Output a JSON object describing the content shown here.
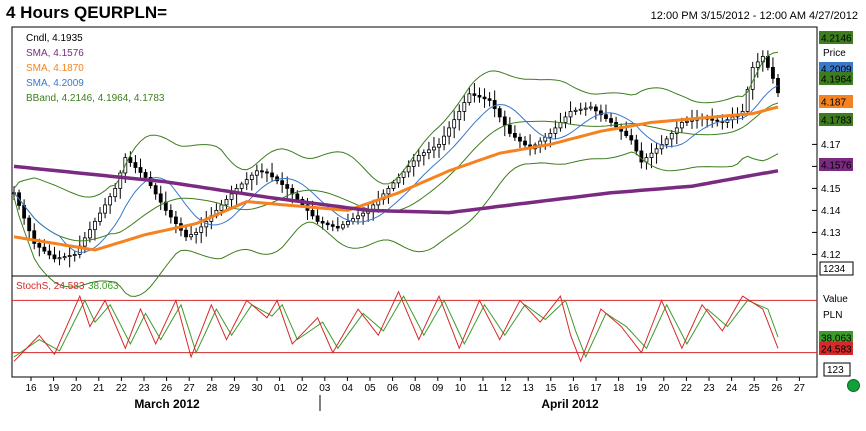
{
  "header": {
    "title": "4 Hours QEURPLN=",
    "range": "12:00 PM 3/15/2012 - 12:00 AM 4/27/2012"
  },
  "chart_data": {
    "type": "line",
    "price_panel": {
      "ylim": [
        4.112,
        4.222
      ],
      "y_ticks": [
        4.12,
        4.13,
        4.14,
        4.15,
        4.16,
        4.17
      ],
      "y_axis_label": "Price",
      "legend": [
        {
          "label": "Cndl, 4.1935",
          "color": "#000000"
        },
        {
          "label": "SMA, 4.1576",
          "color": "#7b2a82"
        },
        {
          "label": "SMA, 4.1870",
          "color": "#f5821f"
        },
        {
          "label": "SMA, 4.2009",
          "color": "#3a78c8"
        },
        {
          "label": "BBand, 4.2146, 4.1964, 4.1783",
          "color": "#3d7d1e"
        }
      ],
      "value_tags": [
        {
          "value": "4.2146",
          "bg": "#3d7d1e",
          "fg": "#ffffff"
        },
        {
          "value": "4.2009",
          "bg": "#3a78c8",
          "fg": "#ffffff"
        },
        {
          "value": "4.1964",
          "bg": "#3d7d1e",
          "fg": "#ffffff"
        },
        {
          "value": "4.187",
          "bg": "#f5821f",
          "fg": "#000000"
        },
        {
          "value": "4.1783",
          "bg": "#3d7d1e",
          "fg": "#ffffff"
        },
        {
          "value": "4.1576",
          "bg": "#7b2a82",
          "fg": "#ffffff"
        }
      ],
      "scale_box": "1234",
      "close_anchors": [
        [
          0,
          4.148
        ],
        [
          4,
          4.125
        ],
        [
          8,
          4.118
        ],
        [
          12,
          4.12
        ],
        [
          16,
          4.135
        ],
        [
          20,
          4.15
        ],
        [
          22,
          4.164
        ],
        [
          26,
          4.155
        ],
        [
          30,
          4.14
        ],
        [
          34,
          4.128
        ],
        [
          36,
          4.13
        ],
        [
          40,
          4.14
        ],
        [
          44,
          4.15
        ],
        [
          48,
          4.158
        ],
        [
          50,
          4.157
        ],
        [
          54,
          4.15
        ],
        [
          58,
          4.14
        ],
        [
          60,
          4.135
        ],
        [
          64,
          4.132
        ],
        [
          66,
          4.135
        ],
        [
          70,
          4.14
        ],
        [
          74,
          4.15
        ],
        [
          78,
          4.16
        ],
        [
          80,
          4.165
        ],
        [
          84,
          4.17
        ],
        [
          88,
          4.185
        ],
        [
          90,
          4.193
        ],
        [
          94,
          4.19
        ],
        [
          98,
          4.175
        ],
        [
          102,
          4.168
        ],
        [
          106,
          4.175
        ],
        [
          110,
          4.185
        ],
        [
          114,
          4.187
        ],
        [
          118,
          4.18
        ],
        [
          122,
          4.172
        ],
        [
          124,
          4.162
        ],
        [
          128,
          4.17
        ],
        [
          132,
          4.18
        ],
        [
          136,
          4.182
        ],
        [
          140,
          4.18
        ],
        [
          144,
          4.185
        ],
        [
          146,
          4.205
        ],
        [
          148,
          4.21
        ],
        [
          150,
          4.2
        ],
        [
          151,
          4.1935
        ]
      ],
      "sma_purple": [
        [
          0,
          4.16
        ],
        [
          30,
          4.153
        ],
        [
          50,
          4.146
        ],
        [
          70,
          4.14
        ],
        [
          86,
          4.139
        ],
        [
          100,
          4.143
        ],
        [
          118,
          4.148
        ],
        [
          134,
          4.151
        ],
        [
          146,
          4.156
        ],
        [
          151,
          4.158
        ]
      ],
      "sma_orange": [
        [
          0,
          4.128
        ],
        [
          8,
          4.125
        ],
        [
          16,
          4.122
        ],
        [
          26,
          4.129
        ],
        [
          36,
          4.134
        ],
        [
          46,
          4.144
        ],
        [
          56,
          4.142
        ],
        [
          66,
          4.14
        ],
        [
          76,
          4.148
        ],
        [
          86,
          4.158
        ],
        [
          96,
          4.166
        ],
        [
          106,
          4.17
        ],
        [
          116,
          4.176
        ],
        [
          126,
          4.18
        ],
        [
          136,
          4.182
        ],
        [
          146,
          4.184
        ],
        [
          151,
          4.187
        ]
      ]
    },
    "stoch_panel": {
      "legend": [
        {
          "label": "StochS, 24.583",
          "color": "#d42a2a"
        },
        {
          "label": "38.063",
          "color": "#3d9b2a"
        }
      ],
      "ylim": [
        0,
        100
      ],
      "levels": [
        80,
        20
      ],
      "y_axis_labels": [
        "Value",
        "PLN"
      ],
      "value_tags": [
        {
          "value": "38.063",
          "bg": "#3d9b2a",
          "fg": "#ffffff"
        },
        {
          "value": "24.583",
          "bg": "#d42a2a",
          "fg": "#ffffff"
        }
      ],
      "scale_box": "123",
      "k_anchors": [
        [
          0,
          10
        ],
        [
          5,
          40
        ],
        [
          8,
          18
        ],
        [
          13,
          85
        ],
        [
          15,
          50
        ],
        [
          18,
          80
        ],
        [
          22,
          25
        ],
        [
          25,
          70
        ],
        [
          28,
          30
        ],
        [
          32,
          80
        ],
        [
          35,
          15
        ],
        [
          39,
          75
        ],
        [
          42,
          35
        ],
        [
          46,
          80
        ],
        [
          50,
          60
        ],
        [
          52,
          80
        ],
        [
          55,
          30
        ],
        [
          60,
          60
        ],
        [
          63,
          20
        ],
        [
          68,
          70
        ],
        [
          72,
          40
        ],
        [
          76,
          90
        ],
        [
          80,
          35
        ],
        [
          84,
          85
        ],
        [
          88,
          25
        ],
        [
          92,
          80
        ],
        [
          96,
          35
        ],
        [
          100,
          80
        ],
        [
          104,
          55
        ],
        [
          108,
          85
        ],
        [
          110,
          40
        ],
        [
          112,
          10
        ],
        [
          116,
          70
        ],
        [
          120,
          50
        ],
        [
          124,
          20
        ],
        [
          128,
          80
        ],
        [
          132,
          25
        ],
        [
          136,
          75
        ],
        [
          140,
          45
        ],
        [
          144,
          85
        ],
        [
          148,
          70
        ],
        [
          151,
          25
        ]
      ],
      "d_anchors": [
        [
          0,
          15
        ],
        [
          5,
          35
        ],
        [
          9,
          22
        ],
        [
          14,
          80
        ],
        [
          16,
          55
        ],
        [
          19,
          75
        ],
        [
          23,
          30
        ],
        [
          26,
          65
        ],
        [
          29,
          35
        ],
        [
          33,
          75
        ],
        [
          36,
          20
        ],
        [
          40,
          70
        ],
        [
          43,
          40
        ],
        [
          47,
          75
        ],
        [
          51,
          62
        ],
        [
          53,
          75
        ],
        [
          56,
          35
        ],
        [
          61,
          55
        ],
        [
          64,
          25
        ],
        [
          69,
          65
        ],
        [
          73,
          45
        ],
        [
          77,
          85
        ],
        [
          81,
          40
        ],
        [
          85,
          80
        ],
        [
          89,
          30
        ],
        [
          93,
          75
        ],
        [
          97,
          40
        ],
        [
          101,
          75
        ],
        [
          105,
          58
        ],
        [
          109,
          80
        ],
        [
          111,
          45
        ],
        [
          113,
          15
        ],
        [
          117,
          65
        ],
        [
          121,
          50
        ],
        [
          125,
          25
        ],
        [
          129,
          75
        ],
        [
          133,
          30
        ],
        [
          137,
          70
        ],
        [
          141,
          50
        ],
        [
          145,
          80
        ],
        [
          149,
          70
        ],
        [
          151,
          38
        ]
      ]
    },
    "x_axis": {
      "tick_labels": [
        "16",
        "19",
        "20",
        "21",
        "22",
        "23",
        "26",
        "27",
        "28",
        "29",
        "30",
        "01",
        "02",
        "03",
        "04",
        "05",
        "06",
        "08",
        "09",
        "10",
        "11",
        "12",
        "13",
        "15",
        "16",
        "17",
        "18",
        "19",
        "20",
        "22",
        "23",
        "24",
        "25",
        "26",
        "27"
      ],
      "month_labels": [
        "March 2012",
        "April 2012"
      ]
    }
  }
}
